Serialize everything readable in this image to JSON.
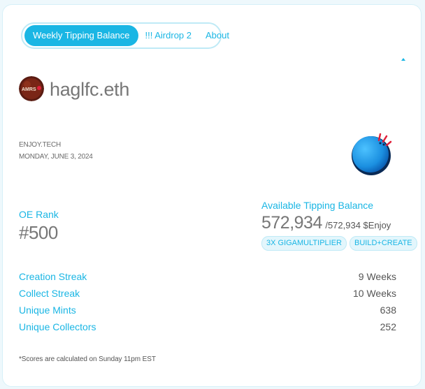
{
  "tabs": [
    {
      "label": "Weekly Tipping Balance",
      "active": true
    },
    {
      "label": "!!! Airdrop 2"
    },
    {
      "label": "About"
    }
  ],
  "profile": {
    "username": "haglfc.eth",
    "avatar_text": "AMRS"
  },
  "info": {
    "site": "ENJOY.TECH",
    "date": "MONDAY, JUNE 3, 2024"
  },
  "rank": {
    "label": "OE Rank",
    "value": "#500"
  },
  "balance": {
    "label": "Available Tipping Balance",
    "available": "572,934",
    "total": "/572,934 $Enjoy",
    "badges": [
      "3X GIGAMULTIPLIER",
      "BUILD+CREATE"
    ]
  },
  "stats": [
    {
      "label": "Creation Streak",
      "value": "9 Weeks"
    },
    {
      "label": "Collect Streak",
      "value": "10 Weeks"
    },
    {
      "label": "Unique Mints",
      "value": "638"
    },
    {
      "label": "Unique Collectors",
      "value": "252"
    }
  ],
  "footnote": "*Scores are calculated on Sunday 11pm EST",
  "colors": {
    "accent": "#1ab6e4",
    "text_gray": "#777777",
    "badge_bg": "#e3f6fc",
    "ball_blue": "#1b8fe0",
    "ball_marks": "#e0203a"
  },
  "icons": {
    "avatar": "profile-avatar",
    "mascot": "blue-ball-mascot-icon",
    "collapse": "caret-up-icon"
  }
}
